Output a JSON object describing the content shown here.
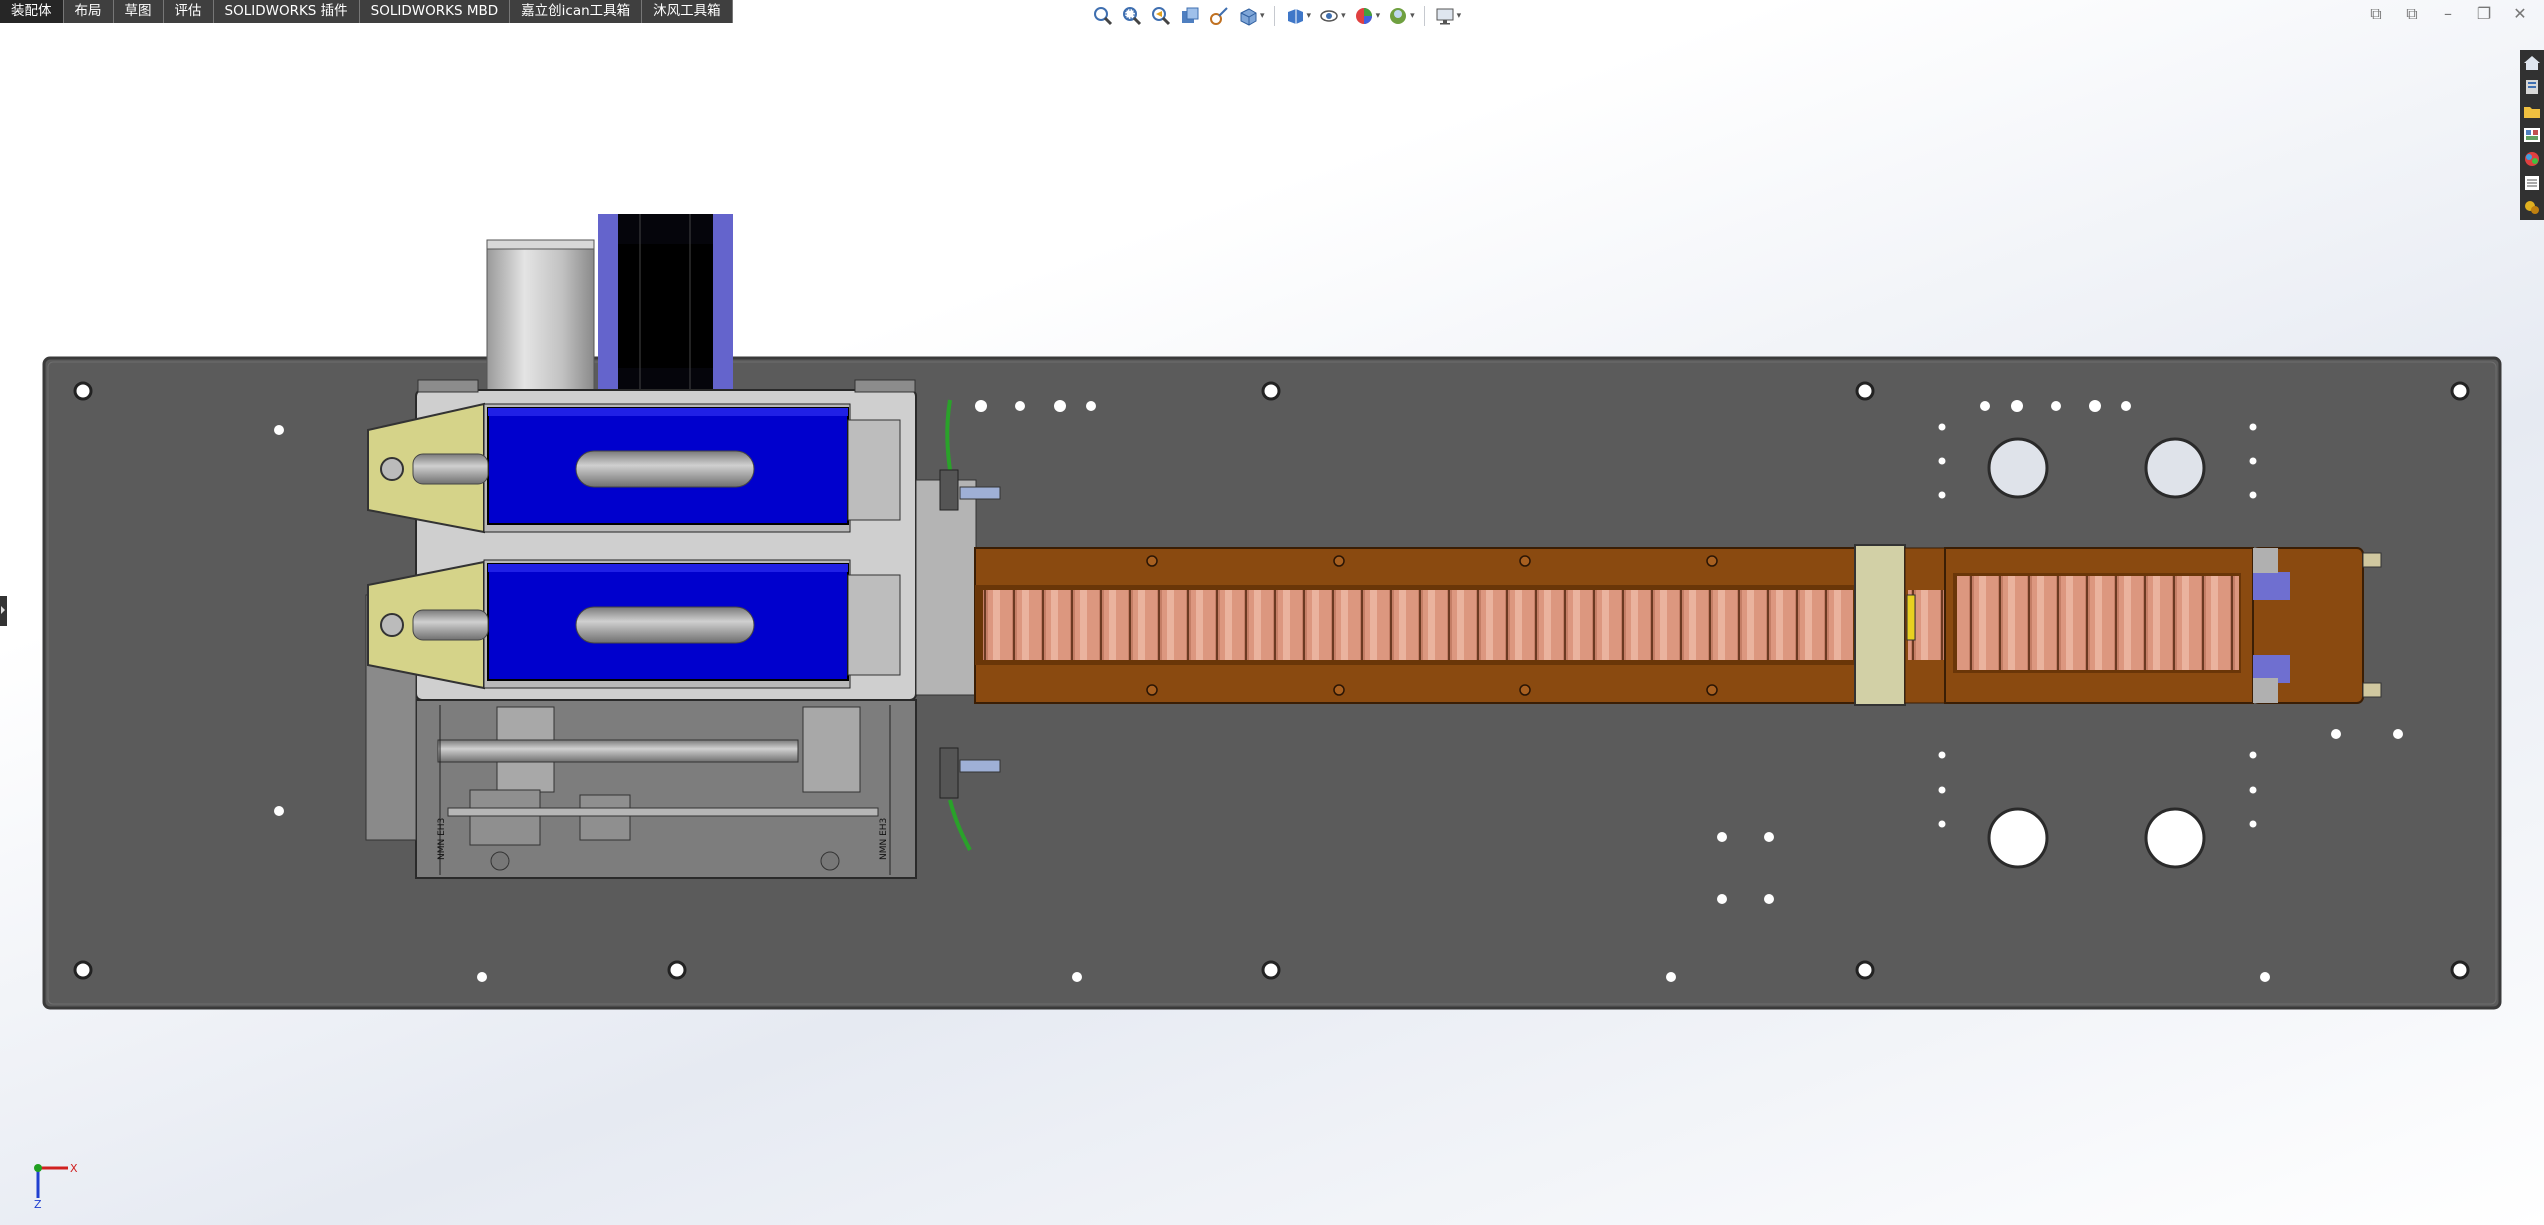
{
  "tabs": [
    {
      "label": "装配体",
      "active": true
    },
    {
      "label": "布局",
      "active": false
    },
    {
      "label": "草图",
      "active": false
    },
    {
      "label": "评估",
      "active": false
    },
    {
      "label": "SOLIDWORKS 插件",
      "active": false
    },
    {
      "label": "SOLIDWORKS MBD",
      "active": false
    },
    {
      "label": "嘉立创ican工具箱",
      "active": false
    },
    {
      "label": "沐风工具箱",
      "active": false
    }
  ],
  "heads_up_toolbar": [
    "zoom-to-fit-icon",
    "zoom-to-area-icon",
    "previous-view-icon",
    "section-view-icon",
    "dynamic-annotation-icon",
    "view-orientation-icon",
    "display-style-icon",
    "hide-show-items-icon",
    "edit-appearance-icon",
    "apply-scene-icon",
    "view-settings-icon"
  ],
  "window_controls": [
    "tile-left-icon",
    "tile-right-icon",
    "minimize-icon",
    "close-icon"
  ],
  "task_pane": [
    "solidworks-resources-icon",
    "design-library-icon",
    "file-explorer-icon",
    "view-palette-icon",
    "appearances-icon",
    "custom-properties-icon",
    "toolbox-icon"
  ],
  "triad": {
    "x_label": "X",
    "z_label": "Z"
  },
  "model": {
    "part_label_left": "NMN EH3",
    "part_label_right": "NMN EH3"
  },
  "colors": {
    "base_plate": "#595959",
    "motor_blue": "#0000cc",
    "khaki_bracket": "#d6d68a",
    "conveyor_brown": "#8a4a10",
    "battery_copper": "#cf8870",
    "stepper_black": "#000000",
    "stepper_cap": "#6060c8",
    "cable_green": "#2aa22a"
  }
}
